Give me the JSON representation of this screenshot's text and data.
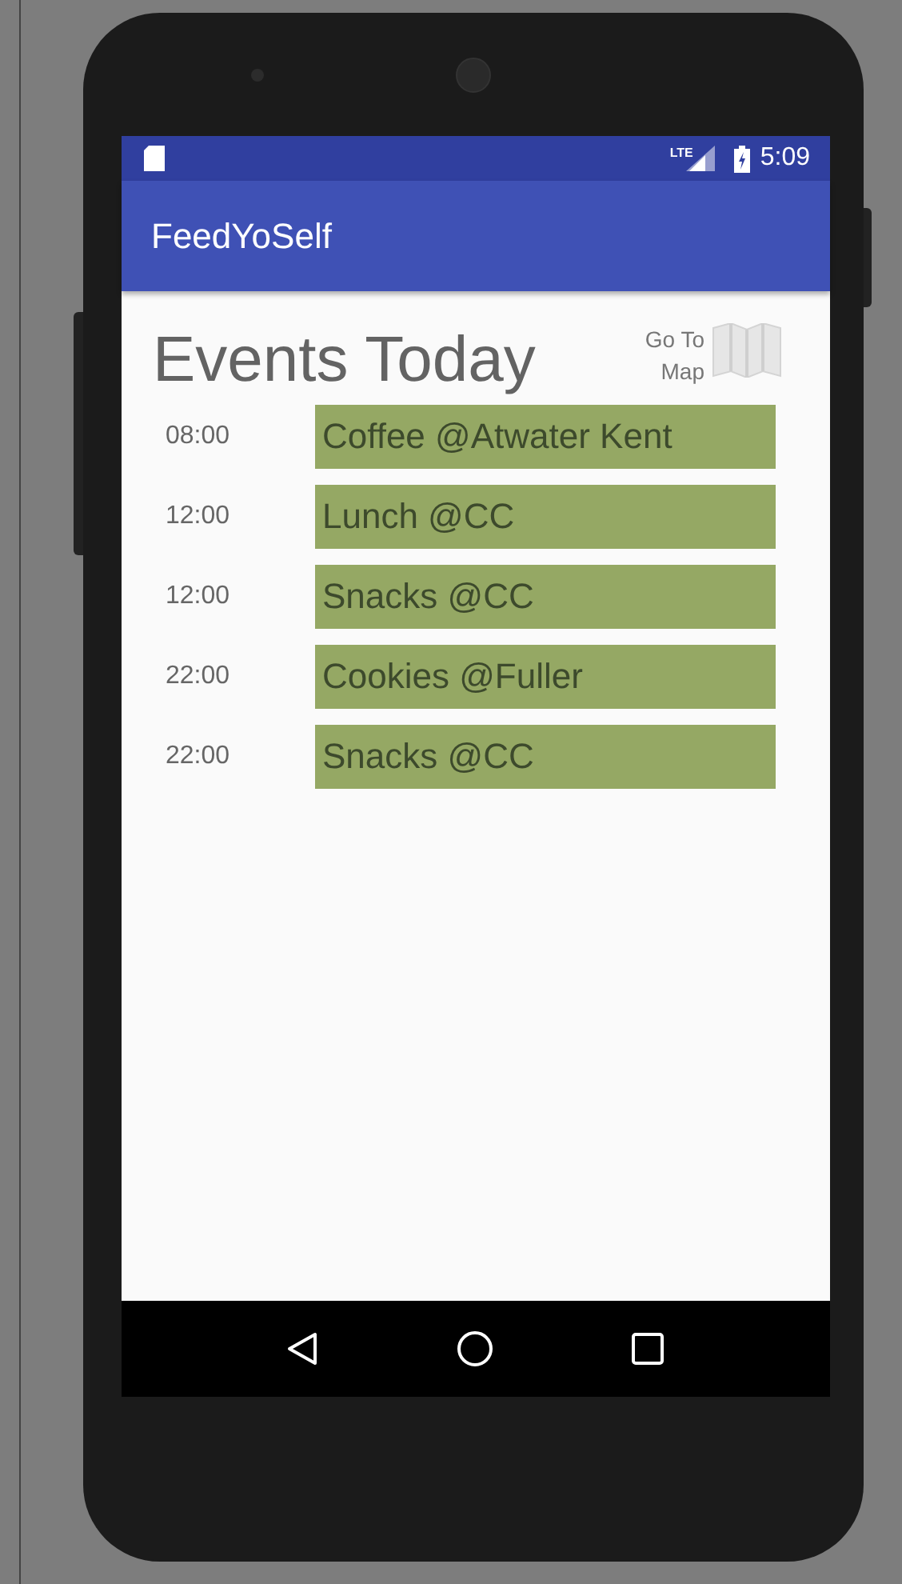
{
  "status_bar": {
    "network": "LTE",
    "time": "5:09"
  },
  "app_bar": {
    "title": "FeedYoSelf"
  },
  "heading": "Events Today",
  "map_button": {
    "label": "Go To Map"
  },
  "events": [
    {
      "time": "08:00",
      "title": "Coffee @Atwater Kent"
    },
    {
      "time": "12:00",
      "title": "Lunch @CC"
    },
    {
      "time": "12:00",
      "title": "Snacks @CC"
    },
    {
      "time": "22:00",
      "title": "Cookies @Fuller"
    },
    {
      "time": "22:00",
      "title": "Snacks @CC"
    }
  ]
}
